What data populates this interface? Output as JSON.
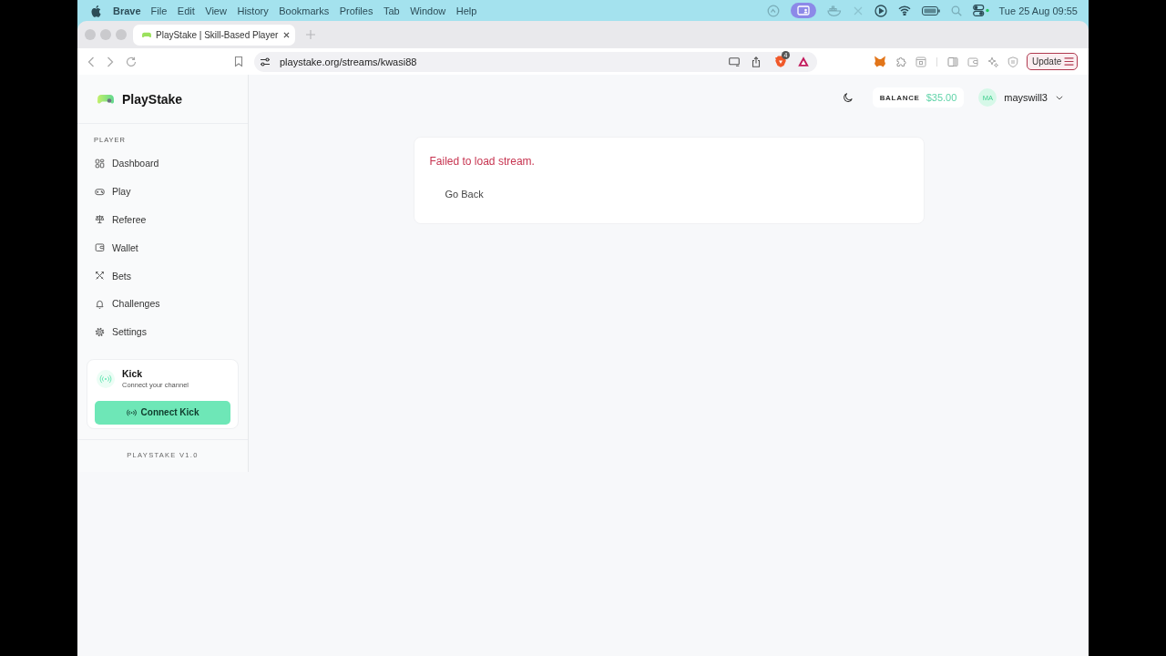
{
  "menu_bar": {
    "app_name": "Brave",
    "menus": [
      "File",
      "Edit",
      "View",
      "History",
      "Bookmarks",
      "Profiles",
      "Tab",
      "Window",
      "Help"
    ],
    "clock": "Tue 25 Aug 09:55"
  },
  "browser": {
    "tabs": [
      {
        "title": "PlayStake | Skill-Based Player",
        "selected": true
      }
    ],
    "address": "playstake.org/streams/kwasi88",
    "shields_count": "4",
    "update_button": "Update"
  },
  "sidebar": {
    "brand": "PlayStake",
    "section_label": "PLAYER",
    "items": [
      {
        "label": "Dashboard",
        "selected": false
      },
      {
        "label": "Play",
        "selected": false
      },
      {
        "label": "Referee",
        "selected": false
      },
      {
        "label": "Wallet",
        "selected": false
      },
      {
        "label": "Bets",
        "selected": false
      },
      {
        "label": "Challenges",
        "selected": false
      },
      {
        "label": "Settings",
        "selected": false
      }
    ],
    "kick_card": {
      "title": "Kick",
      "subtitle": "Connect your channel",
      "button": "Connect Kick"
    },
    "version": "PLAYSTAKE V1.0"
  },
  "header": {
    "balance_label": "BALANCE",
    "balance": "$35.00",
    "avatar_initials": "MA",
    "username": "mayswill3"
  },
  "error_card": {
    "message": "Failed to load stream.",
    "button": "Go Back"
  }
}
